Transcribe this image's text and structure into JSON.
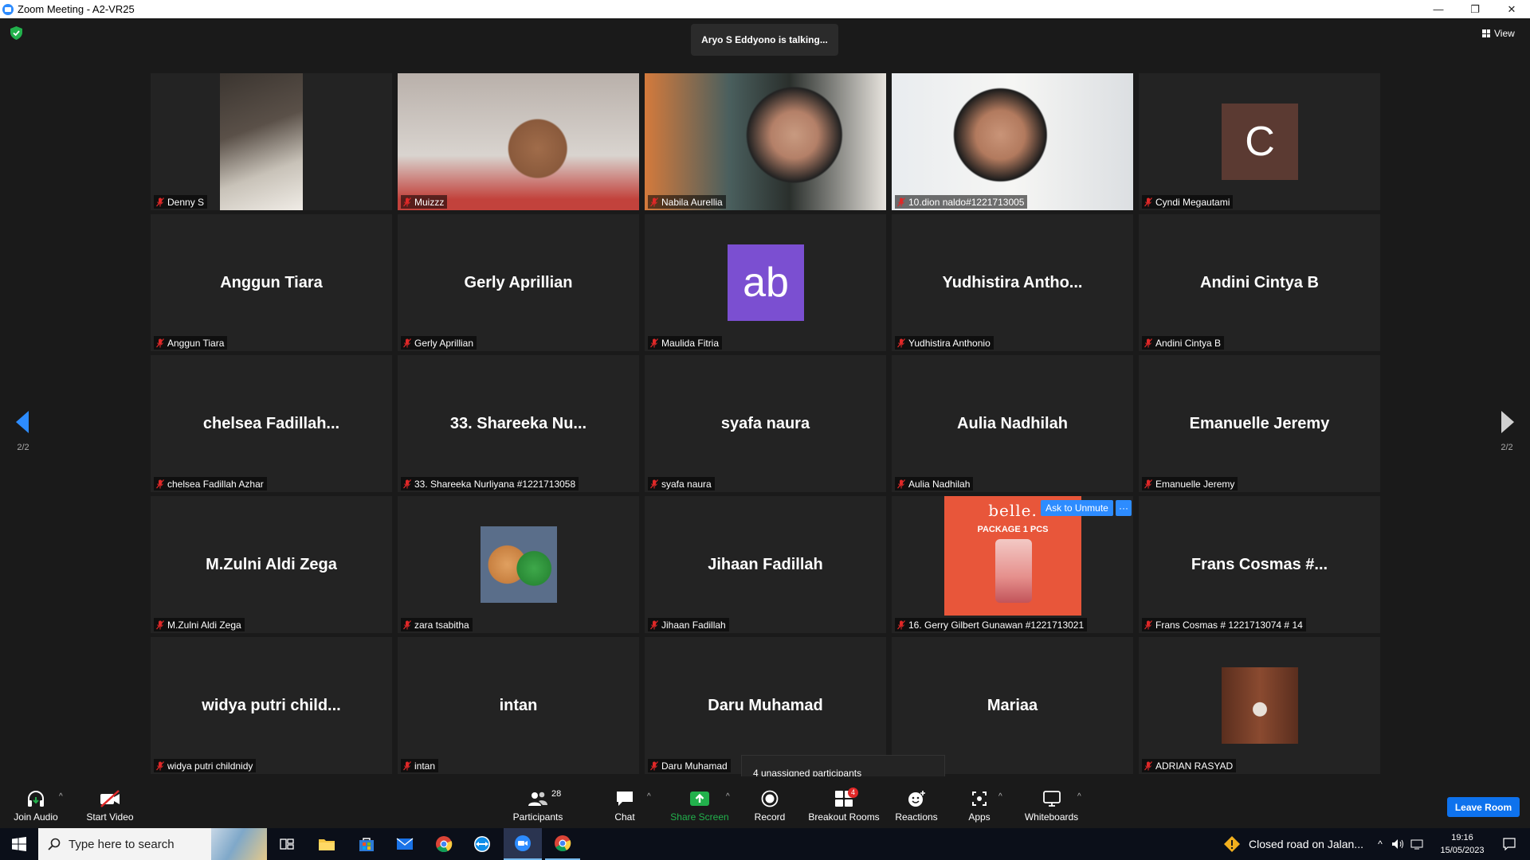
{
  "window": {
    "title": "Zoom Meeting - A2-VR25",
    "controls": {
      "minimize": "—",
      "restore": "❐",
      "close": "✕"
    }
  },
  "stage": {
    "talking_banner": "Aryo S Eddyono is talking...",
    "view_label": "View",
    "page_left": "2/2",
    "page_right": "2/2"
  },
  "tiles": [
    {
      "label": "Denny S",
      "display": ""
    },
    {
      "label": "Muizzz",
      "display": ""
    },
    {
      "label": "Nabila Aurellia",
      "display": ""
    },
    {
      "label": "10.dion naldo#1221713005",
      "display": ""
    },
    {
      "label": "Cyndi Megautami",
      "display": "",
      "avatar_text": "C"
    },
    {
      "label": "Anggun Tiara",
      "display": "Anggun Tiara"
    },
    {
      "label": "Gerly Aprillian",
      "display": "Gerly Aprillian"
    },
    {
      "label": "Maulida Fitria",
      "display": "",
      "avatar_text": "ab"
    },
    {
      "label": "Yudhistira Anthonio",
      "display": "Yudhistira  Antho..."
    },
    {
      "label": "Andini Cintya B",
      "display": "Andini Cintya B"
    },
    {
      "label": "chelsea Fadillah Azhar",
      "display": "chelsea  Fadillah..."
    },
    {
      "label": "33. Shareeka Nurliyana #1221713058",
      "display": "33. Shareeka Nu..."
    },
    {
      "label": "syafa naura",
      "display": "syafa naura"
    },
    {
      "label": "Aulia Nadhilah",
      "display": "Aulia Nadhilah"
    },
    {
      "label": "Emanuelle Jeremy",
      "display": "Emanuelle Jeremy"
    },
    {
      "label": "M.Zulni Aldi Zega",
      "display": "M.Zulni Aldi Zega"
    },
    {
      "label": "zara tsabitha",
      "display": ""
    },
    {
      "label": "Jihaan Fadillah",
      "display": "Jihaan Fadillah"
    },
    {
      "label": "16. Gerry Gilbert Gunawan #1221713021",
      "display": "",
      "photo_title": "belle.",
      "photo_subtitle": "PACKAGE 1 PCS"
    },
    {
      "label": "Frans Cosmas # 1221713074 # 14",
      "display": "Frans Cosmas #..."
    },
    {
      "label": "widya putri childnidy",
      "display": "widya putri child..."
    },
    {
      "label": "intan",
      "display": "intan"
    },
    {
      "label": "Daru Muhamad",
      "display": "Daru Muhamad"
    },
    {
      "label": "",
      "display": "Mariaa"
    },
    {
      "label": "ADRIAN RASYAD",
      "display": ""
    }
  ],
  "overlays": {
    "ask_to_unmute": "Ask to Unmute",
    "more": "···",
    "unassigned": "4 unassigned participants"
  },
  "toolbar": {
    "join_audio": "Join Audio",
    "start_video": "Start Video",
    "participants": "Participants",
    "participants_count": "28",
    "chat": "Chat",
    "share_screen": "Share Screen",
    "record": "Record",
    "breakout_rooms": "Breakout Rooms",
    "breakout_badge": "4",
    "reactions": "Reactions",
    "apps": "Apps",
    "whiteboards": "Whiteboards",
    "leave": "Leave Room"
  },
  "taskbar": {
    "search_placeholder": "Type here to search",
    "news": "Closed road on Jalan...",
    "time": "19:16",
    "date": "15/05/2023"
  },
  "colors": {
    "accent": "#2d8cff",
    "share_green": "#22b14c",
    "mic_red": "#e02828",
    "avatar_brown": "#5b3a32",
    "avatar_purple": "#7b4fd1"
  }
}
